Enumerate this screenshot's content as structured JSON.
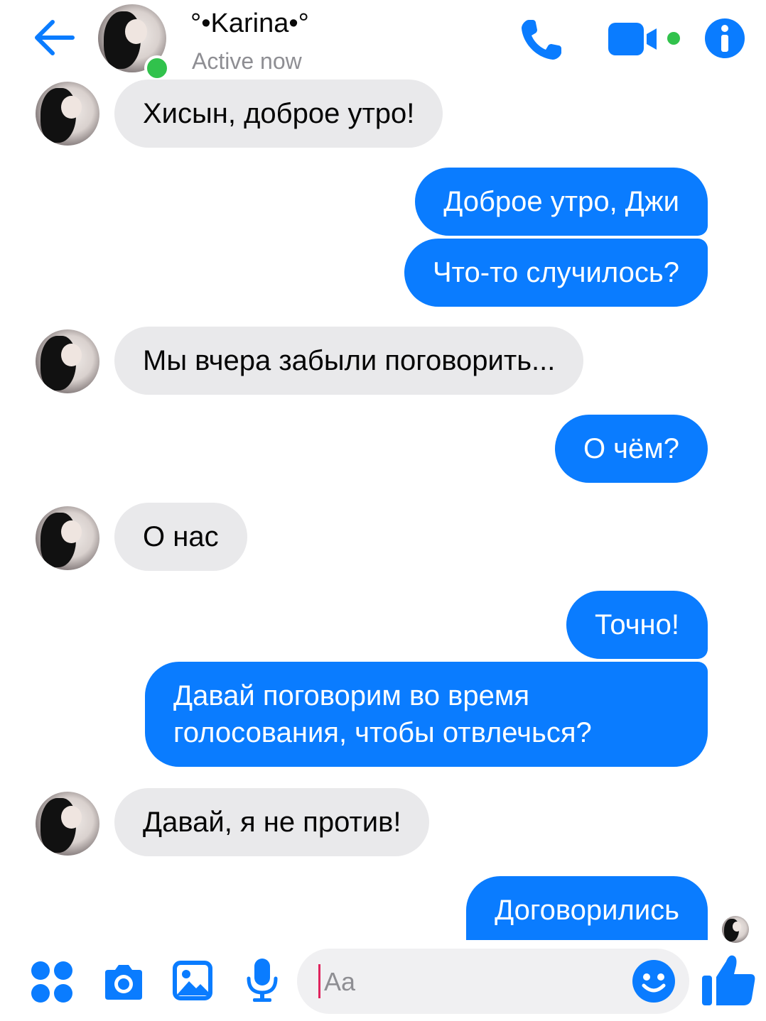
{
  "header": {
    "contact_name": "°•Karina•°",
    "status": "Active now"
  },
  "composer": {
    "placeholder": "Aa"
  },
  "messages": [
    {
      "from": "them",
      "text": "Хисын, доброе утро!"
    },
    {
      "from": "me",
      "text": "Доброе утро, Джи"
    },
    {
      "from": "me",
      "text": "Что-то случилось?"
    },
    {
      "from": "them",
      "text": "Мы вчера забыли поговорить..."
    },
    {
      "from": "me",
      "text": "О чём?"
    },
    {
      "from": "them",
      "text": "О нас"
    },
    {
      "from": "me",
      "text": "Точно!"
    },
    {
      "from": "me",
      "text": "Давай поговорим во время голосования, чтобы отвлечься?"
    },
    {
      "from": "them",
      "text": "Давай, я не против!"
    },
    {
      "from": "me",
      "text": "Договорились"
    }
  ],
  "icons": {
    "back": "arrow-left-icon",
    "call": "phone-icon",
    "video": "video-camera-icon",
    "info": "info-icon",
    "apps": "apps-grid-icon",
    "camera": "camera-icon",
    "gallery": "image-icon",
    "mic": "microphone-icon",
    "emoji": "emoji-icon",
    "like": "thumbs-up-icon"
  },
  "colors": {
    "accent": "#0a7cff",
    "incoming_bubble": "#e9e9eb",
    "online": "#31c24c"
  }
}
